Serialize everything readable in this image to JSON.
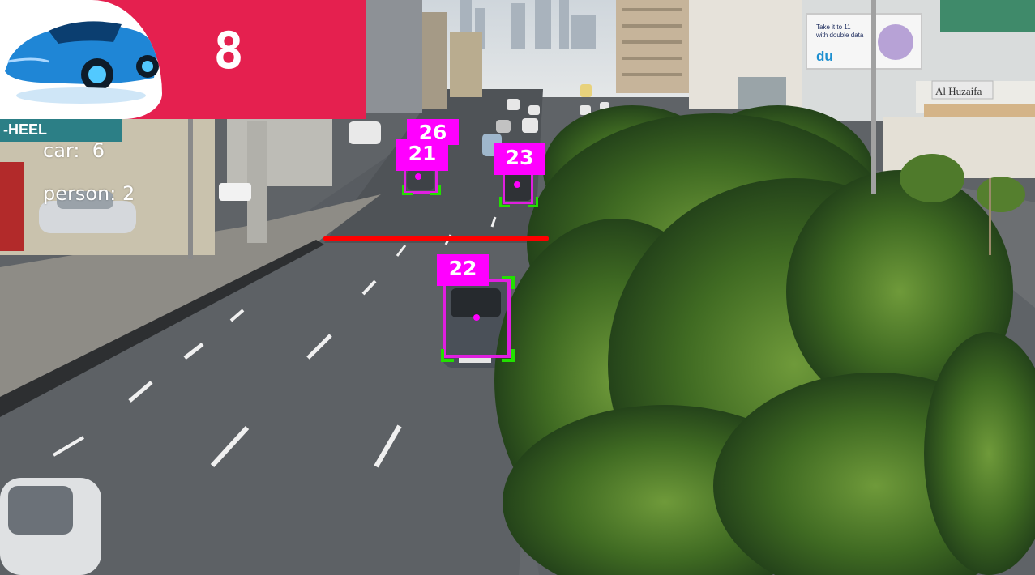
{
  "overlay": {
    "total_count": "8",
    "class_counts": [
      {
        "label": "car:",
        "value": "6"
      },
      {
        "label": "person:",
        "value": "2"
      }
    ],
    "track_ids": [
      "26",
      "21",
      "23",
      "22"
    ],
    "colors": {
      "panel": "#e5204f",
      "tag": "#ff00ff",
      "box": "#e01fe0",
      "corner": "#22e000",
      "count_line": "#ff0000"
    }
  },
  "scene": {
    "billboard_line1": "Take it to 11",
    "billboard_line2": "with double data",
    "billboard_brand": "du",
    "shop_sign": "Al Huzaifa",
    "left_sign": "-HEEL"
  }
}
